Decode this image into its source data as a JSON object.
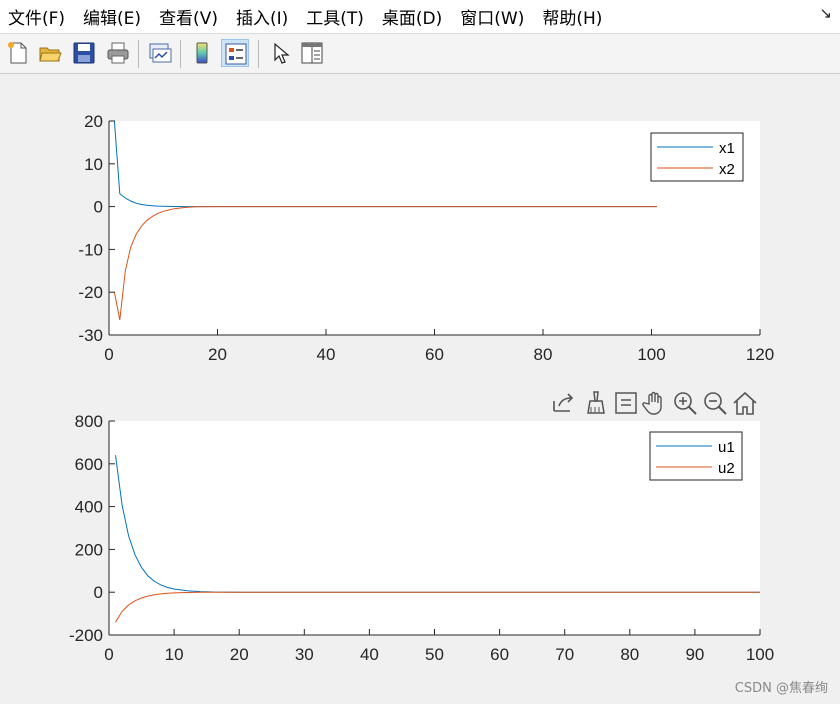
{
  "menubar": {
    "items": [
      "文件(F)",
      "编辑(E)",
      "查看(V)",
      "插入(I)",
      "工具(T)",
      "桌面(D)",
      "窗口(W)",
      "帮助(H)"
    ],
    "overflow_arrow": "↘"
  },
  "toolbar": {
    "buttons": [
      {
        "name": "new-figure-icon"
      },
      {
        "name": "open-file-icon"
      },
      {
        "name": "save-icon"
      },
      {
        "name": "print-icon"
      },
      {
        "name": "link-plot-icon"
      },
      {
        "name": "insert-colorbar-icon"
      },
      {
        "name": "insert-legend-icon",
        "active": true
      },
      {
        "name": "edit-plot-pointer-icon"
      },
      {
        "name": "property-inspector-icon"
      }
    ]
  },
  "axes_toolbar": [
    "export-icon",
    "brush-icon",
    "data-tips-icon",
    "pan-hand-icon",
    "zoom-in-icon",
    "zoom-out-icon",
    "home-icon"
  ],
  "colors": {
    "series1": "#0072BD",
    "series2": "#D95319",
    "axes_bg": "#ffffff",
    "figure_bg": "#f0f0f0"
  },
  "chart_data": [
    {
      "type": "line",
      "xlim": [
        0,
        120
      ],
      "ylim": [
        -30,
        20
      ],
      "xticks": [
        0,
        20,
        40,
        60,
        80,
        100,
        120
      ],
      "yticks": [
        -30,
        -20,
        -10,
        0,
        10,
        20
      ],
      "legend_position": "top-right",
      "grid": false,
      "series": [
        {
          "name": "x1",
          "x": [
            1,
            2,
            3,
            4,
            5,
            6,
            7,
            8,
            9,
            10,
            12,
            14,
            16,
            20,
            101
          ],
          "y": [
            20,
            3,
            2,
            1.3,
            0.8,
            0.5,
            0.3,
            0.2,
            0.12,
            0.08,
            0.03,
            0.01,
            0,
            0,
            0
          ]
        },
        {
          "name": "x2",
          "x": [
            1,
            2,
            3,
            4,
            5,
            6,
            7,
            8,
            9,
            10,
            11,
            12,
            14,
            16,
            20,
            101
          ],
          "y": [
            -20,
            -26.5,
            -15,
            -9.5,
            -6.5,
            -4.5,
            -3.2,
            -2.3,
            -1.6,
            -1.1,
            -0.8,
            -0.5,
            -0.2,
            -0.05,
            0,
            0
          ]
        }
      ]
    },
    {
      "type": "line",
      "xlim": [
        0,
        100
      ],
      "ylim": [
        -200,
        800
      ],
      "xticks": [
        0,
        10,
        20,
        30,
        40,
        50,
        60,
        70,
        80,
        90,
        100
      ],
      "yticks": [
        -200,
        0,
        200,
        400,
        600,
        800
      ],
      "legend_position": "top-right",
      "grid": false,
      "series": [
        {
          "name": "u1",
          "x": [
            1,
            2,
            3,
            4,
            5,
            6,
            7,
            8,
            9,
            10,
            12,
            14,
            16,
            20,
            100
          ],
          "y": [
            640,
            410,
            265,
            175,
            115,
            75,
            50,
            33,
            22,
            15,
            7,
            3,
            1,
            0,
            0
          ]
        },
        {
          "name": "u2",
          "x": [
            1,
            2,
            3,
            4,
            5,
            6,
            7,
            8,
            9,
            10,
            12,
            14,
            16,
            20,
            100
          ],
          "y": [
            -140,
            -90,
            -60,
            -40,
            -27,
            -18,
            -12,
            -8,
            -5,
            -3.5,
            -1.5,
            -0.6,
            -0.2,
            0,
            0
          ]
        }
      ]
    }
  ],
  "watermark": "CSDN @焦春绚"
}
